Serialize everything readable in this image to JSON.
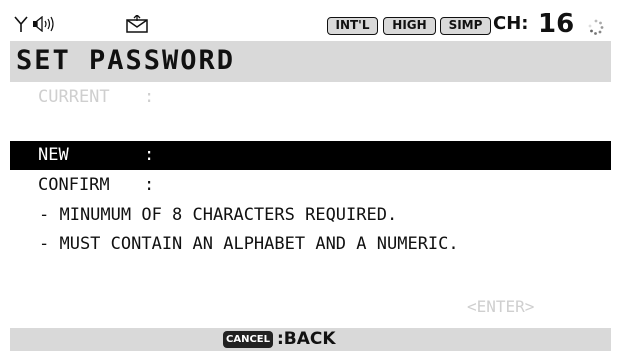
{
  "status": {
    "icons": [
      "antenna-icon",
      "speaker-icon",
      "mail-icon",
      "spinner-icon"
    ],
    "badges": [
      "INT'L",
      "HIGH",
      "SIMP"
    ],
    "channel_label": "CH:",
    "channel_number": "16"
  },
  "title": "SET PASSWORD",
  "fields": [
    {
      "label": "CURRENT",
      "colon": ":",
      "state": "disabled"
    },
    {
      "label": "NEW",
      "colon": ":",
      "state": "selected"
    },
    {
      "label": "CONFIRM",
      "colon": ":",
      "state": "normal"
    }
  ],
  "notes": [
    "- MINUMUM OF 8 CHARACTERS REQUIRED.",
    "- MUST CONTAIN AN ALPHABET AND A NUMERIC."
  ],
  "enter_label": "<ENTER>",
  "softkey": {
    "key": "CANCEL",
    "label": ":BACK"
  },
  "colors": {
    "highlight": "#000000",
    "bar": "#d9d9d9",
    "disabled": "#cfcfcf"
  }
}
